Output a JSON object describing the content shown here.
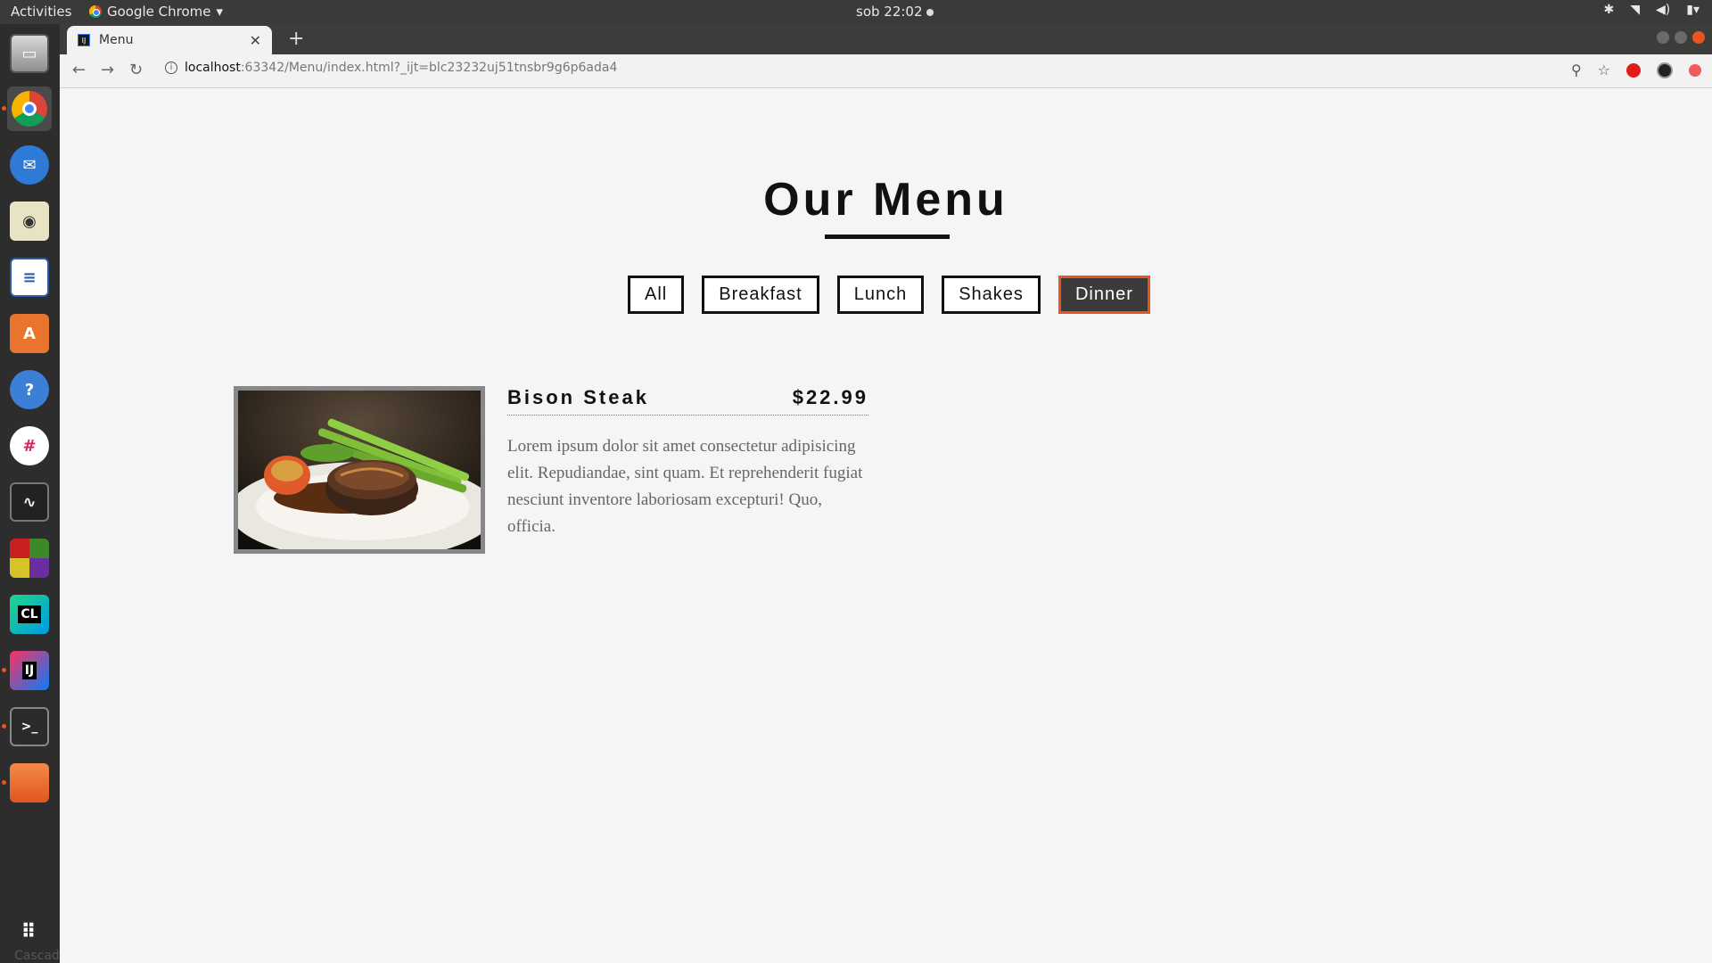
{
  "system_bar": {
    "activities": "Activities",
    "app_name": "Google Chrome",
    "clock": "sob 22:02"
  },
  "dock": {
    "items": [
      "files-drawer-icon",
      "chrome-icon",
      "thunderbird-icon",
      "rhythmbox-icon",
      "writer-icon",
      "software-center-icon",
      "help-icon",
      "slack-icon",
      "system-monitor-icon",
      "mosaic-icon",
      "clion-icon",
      "intellij-icon",
      "terminal-icon",
      "files-icon",
      "show-apps-icon"
    ],
    "watermark": "Cascade"
  },
  "browser": {
    "tab_title": "Menu",
    "url_host": "localhost",
    "url_path": ":63342/Menu/index.html?_ijt=blc23232uj51tnsbr9g6p6ada4"
  },
  "page": {
    "title": "Our Menu",
    "filters": [
      "All",
      "Breakfast",
      "Lunch",
      "Shakes",
      "Dinner"
    ],
    "active_filter": "Dinner",
    "item": {
      "name": "Bison Steak",
      "price": "$22.99",
      "description": "Lorem ipsum dolor sit amet consectetur adipisicing elit. Repudiandae, sint quam. Et reprehenderit fugiat nesciunt inventore laboriosam excepturi! Quo, officia."
    }
  },
  "colors": {
    "accent": "#e95420",
    "active_button_bg": "#3b3b3b",
    "page_bg": "#f5f5f5"
  }
}
